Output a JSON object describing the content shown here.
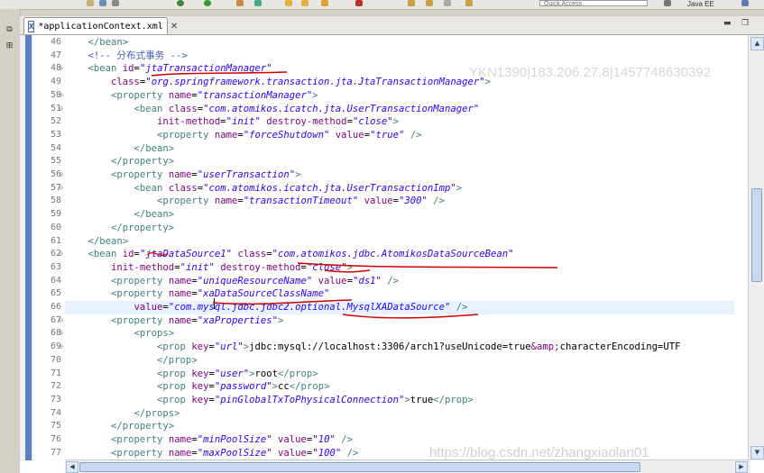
{
  "toolbar": {
    "quick_access_placeholder": "Quick Access",
    "perspective_label": "Java EE"
  },
  "editor_tab": {
    "icon_label": "X",
    "title": "*applicationContext.xml",
    "close_glyph": "✕"
  },
  "watermark_top": "YKN1390|183.206.27.8|1457748630392",
  "watermark_bottom": "https://blog.csdn.net/zhangxiaolan01",
  "colors": {
    "tag": "#3f7f7f",
    "attribute": "#7f007f",
    "value": "#2a00ff",
    "comment": "#3f5fbf",
    "annotation": "#d00000",
    "line_highlight": "#e8f2fe"
  },
  "highlight_line": 66,
  "lines": [
    {
      "n": "46",
      "fold": "",
      "parts": [
        {
          "c": "tag",
          "t": "    </bean>"
        }
      ]
    },
    {
      "n": "47",
      "fold": "",
      "parts": [
        {
          "c": "cmt",
          "t": "    <!-- 分布式事务 -->"
        }
      ]
    },
    {
      "n": "48",
      "fold": "⊖",
      "parts": [
        {
          "c": "tag",
          "t": "    <bean "
        },
        {
          "c": "attr",
          "t": "id"
        },
        {
          "c": "txt",
          "t": "="
        },
        {
          "c": "val",
          "t": "\"jtaTransactionManager\""
        }
      ]
    },
    {
      "n": "49",
      "fold": "",
      "parts": [
        {
          "c": "attr",
          "t": "        class"
        },
        {
          "c": "txt",
          "t": "="
        },
        {
          "c": "val",
          "t": "\"org.springframework.transaction.jta.JtaTransactionManager\""
        },
        {
          "c": "tag",
          "t": ">"
        }
      ]
    },
    {
      "n": "50",
      "fold": "⊖",
      "parts": [
        {
          "c": "tag",
          "t": "        <property "
        },
        {
          "c": "attr",
          "t": "name"
        },
        {
          "c": "txt",
          "t": "="
        },
        {
          "c": "val",
          "t": "\"transactionManager\""
        },
        {
          "c": "tag",
          "t": ">"
        }
      ]
    },
    {
      "n": "51",
      "fold": "⊖",
      "parts": [
        {
          "c": "tag",
          "t": "            <bean "
        },
        {
          "c": "attr",
          "t": "class"
        },
        {
          "c": "txt",
          "t": "="
        },
        {
          "c": "val",
          "t": "\"com.atomikos.icatch.jta.UserTransactionManager\""
        }
      ]
    },
    {
      "n": "52",
      "fold": "",
      "parts": [
        {
          "c": "attr",
          "t": "                init-method"
        },
        {
          "c": "txt",
          "t": "="
        },
        {
          "c": "val",
          "t": "\"init\""
        },
        {
          "c": "attr",
          "t": " destroy-method"
        },
        {
          "c": "txt",
          "t": "="
        },
        {
          "c": "val",
          "t": "\"close\""
        },
        {
          "c": "tag",
          "t": ">"
        }
      ]
    },
    {
      "n": "53",
      "fold": "",
      "parts": [
        {
          "c": "tag",
          "t": "                <property "
        },
        {
          "c": "attr",
          "t": "name"
        },
        {
          "c": "txt",
          "t": "="
        },
        {
          "c": "val",
          "t": "\"forceShutdown\""
        },
        {
          "c": "attr",
          "t": " value"
        },
        {
          "c": "txt",
          "t": "="
        },
        {
          "c": "val",
          "t": "\"true\""
        },
        {
          "c": "tag",
          "t": " />"
        }
      ]
    },
    {
      "n": "54",
      "fold": "",
      "parts": [
        {
          "c": "tag",
          "t": "            </bean>"
        }
      ]
    },
    {
      "n": "55",
      "fold": "",
      "parts": [
        {
          "c": "tag",
          "t": "        </property>"
        }
      ]
    },
    {
      "n": "56",
      "fold": "⊖",
      "parts": [
        {
          "c": "tag",
          "t": "        <property "
        },
        {
          "c": "attr",
          "t": "name"
        },
        {
          "c": "txt",
          "t": "="
        },
        {
          "c": "val",
          "t": "\"userTransaction\""
        },
        {
          "c": "tag",
          "t": ">"
        }
      ]
    },
    {
      "n": "57",
      "fold": "⊖",
      "parts": [
        {
          "c": "tag",
          "t": "            <bean "
        },
        {
          "c": "attr",
          "t": "class"
        },
        {
          "c": "txt",
          "t": "="
        },
        {
          "c": "val",
          "t": "\"com.atomikos.icatch.jta.UserTransactionImp\""
        },
        {
          "c": "tag",
          "t": ">"
        }
      ]
    },
    {
      "n": "58",
      "fold": "",
      "parts": [
        {
          "c": "tag",
          "t": "                <property "
        },
        {
          "c": "attr",
          "t": "name"
        },
        {
          "c": "txt",
          "t": "="
        },
        {
          "c": "val",
          "t": "\"transactionTimeout\""
        },
        {
          "c": "attr",
          "t": " value"
        },
        {
          "c": "txt",
          "t": "="
        },
        {
          "c": "val",
          "t": "\"300\""
        },
        {
          "c": "tag",
          "t": " />"
        }
      ]
    },
    {
      "n": "59",
      "fold": "",
      "parts": [
        {
          "c": "tag",
          "t": "            </bean>"
        }
      ]
    },
    {
      "n": "60",
      "fold": "",
      "parts": [
        {
          "c": "tag",
          "t": "        </property>"
        }
      ]
    },
    {
      "n": "61",
      "fold": "",
      "parts": [
        {
          "c": "tag",
          "t": "    </bean>"
        }
      ]
    },
    {
      "n": "62",
      "fold": "⊖",
      "parts": [
        {
          "c": "tag",
          "t": "    <bean "
        },
        {
          "c": "attr",
          "t": "id"
        },
        {
          "c": "txt",
          "t": "="
        },
        {
          "c": "val",
          "t": "\"jtaDataSource1\""
        },
        {
          "c": "attr",
          "t": " class"
        },
        {
          "c": "txt",
          "t": "="
        },
        {
          "c": "val",
          "t": "\"com.atomikos.jdbc.AtomikosDataSourceBean\""
        }
      ]
    },
    {
      "n": "63",
      "fold": "",
      "parts": [
        {
          "c": "attr",
          "t": "        init-method"
        },
        {
          "c": "txt",
          "t": "="
        },
        {
          "c": "val",
          "t": "\"init\""
        },
        {
          "c": "attr",
          "t": " destroy-method"
        },
        {
          "c": "txt",
          "t": "="
        },
        {
          "c": "val",
          "t": "\"close\""
        },
        {
          "c": "tag",
          "t": ">"
        }
      ]
    },
    {
      "n": "64",
      "fold": "",
      "parts": [
        {
          "c": "tag",
          "t": "        <property "
        },
        {
          "c": "attr",
          "t": "name"
        },
        {
          "c": "txt",
          "t": "="
        },
        {
          "c": "val",
          "t": "\"uniqueResourceName\""
        },
        {
          "c": "attr",
          "t": " value"
        },
        {
          "c": "txt",
          "t": "="
        },
        {
          "c": "val",
          "t": "\"ds1\""
        },
        {
          "c": "tag",
          "t": " />"
        }
      ]
    },
    {
      "n": "65",
      "fold": "",
      "parts": [
        {
          "c": "tag",
          "t": "        <property "
        },
        {
          "c": "attr",
          "t": "name"
        },
        {
          "c": "txt",
          "t": "="
        },
        {
          "c": "val",
          "t": "\"xaDataSourceClassName\""
        }
      ]
    },
    {
      "n": "66",
      "fold": "",
      "parts": [
        {
          "c": "attr",
          "t": "            value"
        },
        {
          "c": "txt",
          "t": "="
        },
        {
          "c": "val",
          "t": "\"com.mysql.jdbc.jdbc2.optional.MysqlXADataSource\""
        },
        {
          "c": "tag",
          "t": " />"
        }
      ]
    },
    {
      "n": "67",
      "fold": "⊖",
      "parts": [
        {
          "c": "tag",
          "t": "        <property "
        },
        {
          "c": "attr",
          "t": "name"
        },
        {
          "c": "txt",
          "t": "="
        },
        {
          "c": "val",
          "t": "\"xaProperties\""
        },
        {
          "c": "tag",
          "t": ">"
        }
      ]
    },
    {
      "n": "68",
      "fold": "⊖",
      "parts": [
        {
          "c": "tag",
          "t": "            <props>"
        }
      ]
    },
    {
      "n": "69",
      "fold": "⊖",
      "parts": [
        {
          "c": "tag",
          "t": "                <prop "
        },
        {
          "c": "attr",
          "t": "key"
        },
        {
          "c": "txt",
          "t": "="
        },
        {
          "c": "val",
          "t": "\"url\""
        },
        {
          "c": "tag",
          "t": ">"
        },
        {
          "c": "txt",
          "t": "jdbc:mysql://localhost:3306/arch1?useUnicode=true"
        },
        {
          "c": "attr",
          "t": "&amp;"
        },
        {
          "c": "txt",
          "t": "characterEncoding=UTF"
        }
      ]
    },
    {
      "n": "70",
      "fold": "",
      "parts": [
        {
          "c": "tag",
          "t": "                </prop>"
        }
      ]
    },
    {
      "n": "71",
      "fold": "",
      "parts": [
        {
          "c": "tag",
          "t": "                <prop "
        },
        {
          "c": "attr",
          "t": "key"
        },
        {
          "c": "txt",
          "t": "="
        },
        {
          "c": "val",
          "t": "\"user\""
        },
        {
          "c": "tag",
          "t": ">"
        },
        {
          "c": "txt",
          "t": "root"
        },
        {
          "c": "tag",
          "t": "</prop>"
        }
      ]
    },
    {
      "n": "72",
      "fold": "",
      "parts": [
        {
          "c": "tag",
          "t": "                <prop "
        },
        {
          "c": "attr",
          "t": "key"
        },
        {
          "c": "txt",
          "t": "="
        },
        {
          "c": "val",
          "t": "\"password\""
        },
        {
          "c": "tag",
          "t": ">"
        },
        {
          "c": "txt",
          "t": "cc"
        },
        {
          "c": "tag",
          "t": "</prop>"
        }
      ]
    },
    {
      "n": "73",
      "fold": "",
      "parts": [
        {
          "c": "tag",
          "t": "                <prop "
        },
        {
          "c": "attr",
          "t": "key"
        },
        {
          "c": "txt",
          "t": "="
        },
        {
          "c": "val",
          "t": "\"pinGlobalTxToPhysicalConnection\""
        },
        {
          "c": "tag",
          "t": ">"
        },
        {
          "c": "txt",
          "t": "true"
        },
        {
          "c": "tag",
          "t": "</prop>"
        }
      ]
    },
    {
      "n": "74",
      "fold": "",
      "parts": [
        {
          "c": "tag",
          "t": "            </props>"
        }
      ]
    },
    {
      "n": "75",
      "fold": "",
      "parts": [
        {
          "c": "tag",
          "t": "        </property>"
        }
      ]
    },
    {
      "n": "76",
      "fold": "",
      "parts": [
        {
          "c": "tag",
          "t": "        <property "
        },
        {
          "c": "attr",
          "t": "name"
        },
        {
          "c": "txt",
          "t": "="
        },
        {
          "c": "val",
          "t": "\"minPoolSize\""
        },
        {
          "c": "attr",
          "t": " value"
        },
        {
          "c": "txt",
          "t": "="
        },
        {
          "c": "val",
          "t": "\"10\""
        },
        {
          "c": "tag",
          "t": " />"
        }
      ]
    },
    {
      "n": "77",
      "fold": "",
      "parts": [
        {
          "c": "tag",
          "t": "        <property "
        },
        {
          "c": "attr",
          "t": "name"
        },
        {
          "c": "txt",
          "t": "="
        },
        {
          "c": "val",
          "t": "\"maxPoolSize\""
        },
        {
          "c": "attr",
          "t": " value"
        },
        {
          "c": "txt",
          "t": "="
        },
        {
          "c": "val",
          "t": "\"100\""
        },
        {
          "c": "tag",
          "t": " />"
        }
      ]
    }
  ]
}
